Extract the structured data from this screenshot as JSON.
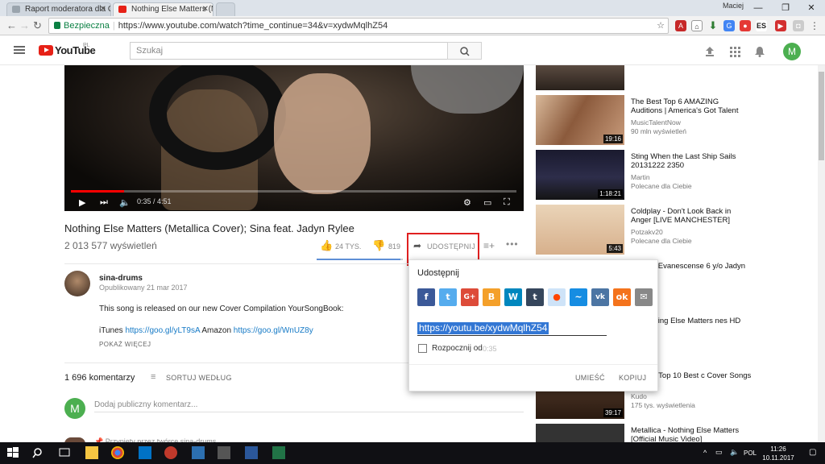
{
  "browser": {
    "tabs": [
      {
        "label": "Raport moderatora dla C"
      },
      {
        "label": "Nothing Else Matters (M"
      }
    ],
    "user": "Maciej",
    "secure_label": "Bezpieczna",
    "url": "https://www.youtube.com/watch?time_continue=34&v=xydwMqlhZ54"
  },
  "youtube": {
    "logo_text": "YouTube",
    "logo_region": "PL",
    "search_placeholder": "Szukaj",
    "user_initial": "M"
  },
  "video": {
    "time": "0:35 / 4:51",
    "progress_fraction": 0.12,
    "title": "Nothing Else Matters (Metallica Cover); Sina feat. Jadyn Rylee",
    "views": "2 013 577 wyświetleń",
    "likes": "24 TYS.",
    "dislikes": "819",
    "like_fraction": 0.97,
    "share_label": "UDOSTĘPNIJ"
  },
  "channel": {
    "name": "sina-drums",
    "published": "Opublikowany 21 mar 2017",
    "description_line1": "This song is released on our new Cover Compilation YourSongBook:",
    "itunes_label": "iTunes",
    "itunes_link": "https://goo.gl/yLT9sA",
    "amazon_label": "Amazon",
    "amazon_link": "https://goo.gl/WnUZ8y",
    "show_more": "POKAŻ WIĘCEJ"
  },
  "comments": {
    "count": "1 696 komentarzy",
    "sort_label": "SORTUJ WEDŁUG",
    "user_initial": "M",
    "placeholder": "Dodaj publiczny komentarz...",
    "pinned": "Przypięty przez twórcę sina-drums"
  },
  "share_dialog": {
    "title": "Udostępnij",
    "link": "https://youtu.be/xydwMqlhZ54",
    "start_label": "Rozpocznij od",
    "start_time": "0:35",
    "embed_label": "UMIEŚĆ",
    "copy_label": "KOPIUJ",
    "services": [
      "facebook",
      "twitter",
      "google-plus",
      "blogger",
      "wordpress",
      "tumblr",
      "reddit",
      "odnoklassniki-wave",
      "vk",
      "odnoklassniki",
      "email"
    ]
  },
  "sidebar": [
    {
      "title": "",
      "channel": "",
      "meta": "",
      "duration": ""
    },
    {
      "title": "The Best Top 6 AMAZING Auditions | America's Got Talent",
      "channel": "MusicTalentNow",
      "meta": "90 mln wyświetleń",
      "duration": "19:16"
    },
    {
      "title": "Sting When the Last Ship Sails 20131222 2350",
      "channel": "Martin",
      "meta": "Polecane dla Ciebie",
      "duration": "1:18:21"
    },
    {
      "title": "Coldplay - Don't Look Back in Anger [LIVE MANCHESTER]",
      "channel": "Potzakv20",
      "meta": "Polecane dla Ciebie",
      "duration": "5:43"
    },
    {
      "title": "ortal by Evanescense 6 y/o Jadyn Rylee",
      "channel": "lee",
      "meta": "",
      "duration": ""
    },
    {
      "title": "a - Nothing Else Matters nes HD",
      "channel": "05",
      "meta": "ń",
      "duration": ""
    },
    {
      "title": "venue - Top 10 Best c Cover Songs",
      "channel": "Kudo",
      "meta": "175 tys. wyświetlenia",
      "duration": "39:17"
    },
    {
      "title": "Metallica - Nothing Else Matters [Official Music Video]",
      "channel": "",
      "meta": "",
      "duration": ""
    }
  ],
  "taskbar": {
    "lang": "POL",
    "time": "11:26",
    "date": "10.11.2017"
  },
  "colors": {
    "yt_red": "#e62117",
    "link_blue": "#167ac6",
    "highlight_red": "#e02020"
  }
}
